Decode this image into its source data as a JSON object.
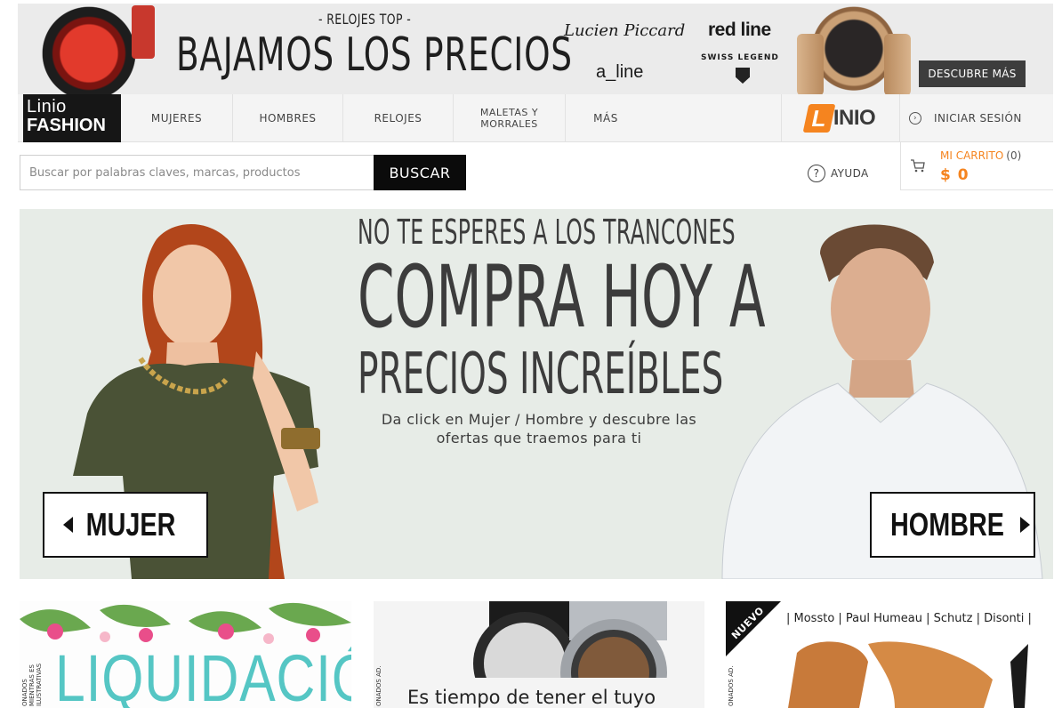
{
  "promo": {
    "subtitle": "- RELOJES TOP -",
    "title": "BAJAMOS LOS PRECIOS",
    "brands": {
      "lucien": "Lucien Piccard",
      "redline": "red line",
      "aline": "a_line",
      "swiss": "SWISS LEGEND"
    },
    "cta_label": "DESCUBRE MÁS"
  },
  "nav": {
    "logo_line1": "Linio",
    "logo_line2": "FASHION",
    "items": [
      "MUJERES",
      "HOMBRES",
      "RELOJES",
      "MALETAS Y MORRALES",
      "MÁS"
    ],
    "linio_letter": "L",
    "linio_rest": "INIO",
    "login_label": "INICIAR SESIÓN"
  },
  "search": {
    "placeholder": "Buscar por palabras claves, marcas, productos",
    "value": "",
    "button_label": "BUSCAR"
  },
  "help": {
    "label": "AYUDA"
  },
  "cart": {
    "label": "MI CARRITO",
    "count": "(0)",
    "total": "$ 0"
  },
  "hero": {
    "line1": "NO TE ESPERES A LOS TRANCONES",
    "line2": "COMPRA HOY A",
    "line3": "PRECIOS INCREÍBLES",
    "desc_line1": "Da click en Mujer / Hombre y descubre las",
    "desc_line2": "ofertas que traemos para ti",
    "mujer_label": "MUJER",
    "hombre_label": "HOMBRE"
  },
  "cards": {
    "liquidacion": {
      "title": "LIQUIDACIÓN",
      "side_note": "ONADOS MIENTRAS ES ILUSTRATIVAS"
    },
    "watch": {
      "caption": "Es tiempo de tener el tuyo",
      "side_note": "ONADOS AD."
    },
    "nuevo": {
      "tag": "NUEVO",
      "brands": "| Mosstо | Paul Humeau | Schutz | Disonti |",
      "side_note": "ONADOS AD."
    }
  },
  "colors": {
    "accent_orange": "#f5841f",
    "dark": "#111111",
    "teal": "#55c6c4",
    "hero_bg": "#e7ece7"
  }
}
